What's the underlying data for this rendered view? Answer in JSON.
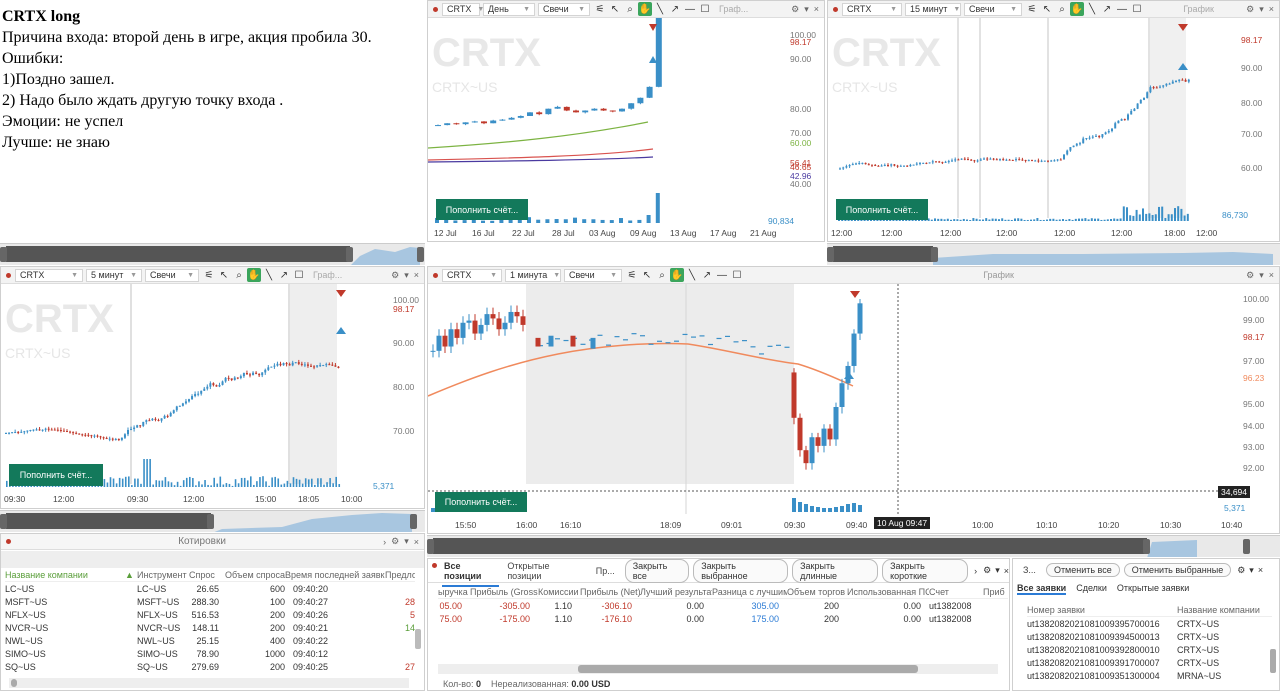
{
  "note": {
    "title": "CRTX long",
    "lines": [
      "Причина входа: второй день в игре, акция пробила 30.",
      "Ошибки:",
      "1)Поздно зашел.",
      "2) Надо было ждать другую точку входа .",
      "Эмоции: не успел",
      "Лучше: не знаю"
    ]
  },
  "colors": {
    "up": "#3a8fc7",
    "down": "#c0392b",
    "accent_green": "#13795b",
    "ma_green": "#7cb342",
    "ma_red": "#d9534f",
    "ma_purple": "#4a3aa0",
    "ma_orange": "#f08a5d"
  },
  "charts": {
    "daily": {
      "ticker": "CRTX",
      "timeframe": "День",
      "chart_type": "Свечи",
      "label": "Граф...",
      "watermark": "CRTX",
      "watermark_sub": "CRTX~US",
      "button": "Пополнить счёт...",
      "volume_label": "90,834",
      "y_labels": [
        "100.00",
        "98.17",
        "90.00",
        "80.00",
        "70.00",
        "60.00",
        "56.41",
        "46.65",
        "42.96",
        "40.00"
      ],
      "x_labels": [
        "12 Jul",
        "16 Jul",
        "22 Jul",
        "28 Jul",
        "03 Aug",
        "09 Aug",
        "13 Aug",
        "17 Aug",
        "21 Aug"
      ]
    },
    "m15": {
      "ticker": "CRTX",
      "timeframe": "15 минут",
      "chart_type": "Свечи",
      "label": "График",
      "watermark": "CRTX",
      "watermark_sub": "CRTX~US",
      "button": "Пополнить счёт...",
      "volume_label": "86,730",
      "y_labels": [
        "98.17",
        "90.00",
        "80.00",
        "70.00",
        "60.00"
      ],
      "x_labels": [
        "12:00",
        "12:00",
        "12:00",
        "12:00",
        "12:00",
        "12:00",
        "18:00",
        "12:00"
      ]
    },
    "m5": {
      "ticker": "CRTX",
      "timeframe": "5 минут",
      "chart_type": "Свечи",
      "label": "Граф...",
      "watermark": "CRTX",
      "watermark_sub": "CRTX~US",
      "button": "Пополнить счёт...",
      "volume_label": "5,371",
      "y_labels": [
        "100.00",
        "98.17",
        "90.00",
        "80.00",
        "70.00"
      ],
      "x_labels": [
        "09:30",
        "12:00",
        "09:30",
        "12:00",
        "15:00",
        "18:05",
        "10:00"
      ]
    },
    "m1": {
      "ticker": "CRTX",
      "timeframe": "1 минута",
      "chart_type": "Свечи",
      "label": "График",
      "button": "Пополнить счёт...",
      "volume_label": "34,694",
      "volume_sub": "5,371",
      "crosshair_label": "10 Aug 09:47",
      "y_labels": [
        "100.00",
        "99.00",
        "98.17",
        "97.00",
        "96.23",
        "95.00",
        "94.00",
        "93.00",
        "92.00"
      ],
      "x_labels": [
        "15:50",
        "16:00",
        "16:10",
        "18:09",
        "09:01",
        "09:30",
        "09:40",
        "10:00",
        "10:10",
        "10:20",
        "10:30",
        "10:40"
      ]
    }
  },
  "quotes": {
    "title": "Котировки",
    "columns": [
      "Название компании",
      "Инструмент",
      "Спрос",
      "Объем спроса",
      "Время последней заявки",
      "Предло"
    ],
    "rows": [
      [
        "LC~US",
        "LC~US",
        "26.65",
        "600",
        "09:40:20",
        ""
      ],
      [
        "MSFT~US",
        "MSFT~US",
        "288.30",
        "100",
        "09:40:27",
        "28"
      ],
      [
        "NFLX~US",
        "NFLX~US",
        "516.53",
        "200",
        "09:40:26",
        "5"
      ],
      [
        "NVCR~US",
        "NVCR~US",
        "148.11",
        "200",
        "09:40:21",
        "14"
      ],
      [
        "NWL~US",
        "NWL~US",
        "25.15",
        "400",
        "09:40:22",
        ""
      ],
      [
        "SIMO~US",
        "SIMO~US",
        "78.90",
        "1000",
        "09:40:12",
        ""
      ],
      [
        "SQ~US",
        "SQ~US",
        "279.69",
        "200",
        "09:40:25",
        "27"
      ]
    ]
  },
  "positions": {
    "tabs": [
      "Все позиции",
      "Открытые позиции",
      "Пр..."
    ],
    "buttons": [
      "Закрыть все",
      "Закрыть выбранное",
      "Закрыть длинные",
      "Закрыть короткие"
    ],
    "columns": [
      "ыручка",
      "Прибыль (Gross)",
      "Комиссии",
      "Прибыль (Net)",
      "Лучший результат",
      "Разница с лучшим",
      "Объем торгов",
      "Использованная ПС",
      "Счет",
      "Прибы"
    ],
    "rows": [
      [
        "05.00",
        "-305.00",
        "1.10",
        "-306.10",
        "0.00",
        "305.00",
        "200",
        "0.00",
        "ut1382008",
        ""
      ],
      [
        "75.00",
        "-175.00",
        "1.10",
        "-176.10",
        "0.00",
        "175.00",
        "200",
        "0.00",
        "ut1382008",
        ""
      ]
    ],
    "footer_qty_label": "Кол-во:",
    "footer_qty": "0",
    "footer_unreal_label": "Нереализованная:",
    "footer_unreal": "0.00 USD"
  },
  "orders": {
    "title": "З...",
    "buttons": [
      "Отменить все",
      "Отменить выбранные"
    ],
    "tabs": [
      "Все заявки",
      "Сделки",
      "Открытые заявки"
    ],
    "columns": [
      "Номер заявки",
      "Название компании"
    ],
    "rows": [
      [
        "ut1382082021081009395700016",
        "CRTX~US"
      ],
      [
        "ut1382082021081009394500013",
        "CRTX~US"
      ],
      [
        "ut1382082021081009392800010",
        "CRTX~US"
      ],
      [
        "ut1382082021081009391700007",
        "CRTX~US"
      ],
      [
        "ut1382082021081009351300004",
        "MRNA~US"
      ]
    ]
  }
}
